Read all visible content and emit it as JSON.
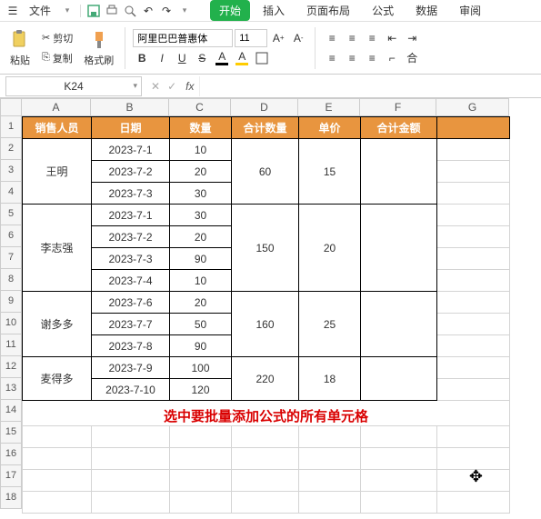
{
  "menubar": {
    "file": "文件",
    "tabs": [
      "开始",
      "插入",
      "页面布局",
      "公式",
      "数据",
      "审阅"
    ],
    "active_tab": 0
  },
  "ribbon": {
    "paste": "粘贴",
    "cut": "剪切",
    "copy": "复制",
    "format_painter": "格式刷",
    "font_name": "阿里巴巴普惠体",
    "font_size": "11",
    "bold": "B",
    "italic": "I",
    "underline": "U",
    "strike": "S",
    "font_color": "A",
    "fill_color": "A",
    "merge": "合"
  },
  "namebox": "K24",
  "formula_prefix": "fx",
  "colors": {
    "header_bg": "#e8953f",
    "annotation": "#d90000"
  },
  "columns": [
    "A",
    "B",
    "C",
    "D",
    "E",
    "F",
    "G"
  ],
  "row_numbers": [
    "1",
    "2",
    "3",
    "4",
    "5",
    "6",
    "7",
    "8",
    "9",
    "10",
    "11",
    "12",
    "13",
    "14",
    "15",
    "16",
    "17",
    "18"
  ],
  "headers": {
    "A": "销售人员",
    "B": "日期",
    "C": "数量",
    "D": "合计数量",
    "E": "单价",
    "F": "合计金额"
  },
  "groups": [
    {
      "name": "王明",
      "rows": [
        [
          "2023-7-1",
          "10"
        ],
        [
          "2023-7-2",
          "20"
        ],
        [
          "2023-7-3",
          "30"
        ]
      ],
      "sum_qty": "60",
      "price": "15"
    },
    {
      "name": "李志强",
      "rows": [
        [
          "2023-7-1",
          "30"
        ],
        [
          "2023-7-2",
          "20"
        ],
        [
          "2023-7-3",
          "90"
        ],
        [
          "2023-7-4",
          "10"
        ]
      ],
      "sum_qty": "150",
      "price": "20"
    },
    {
      "name": "谢多多",
      "rows": [
        [
          "2023-7-6",
          "20"
        ],
        [
          "2023-7-7",
          "50"
        ],
        [
          "2023-7-8",
          "90"
        ]
      ],
      "sum_qty": "160",
      "price": "25"
    },
    {
      "name": "麦得多",
      "rows": [
        [
          "2023-7-9",
          "100"
        ],
        [
          "2023-7-10",
          "120"
        ]
      ],
      "sum_qty": "220",
      "price": "18"
    }
  ],
  "annotation": "选中要批量添加公式的所有单元格",
  "chart_data": {
    "type": "table",
    "title": "",
    "columns": [
      "销售人员",
      "日期",
      "数量",
      "合计数量",
      "单价",
      "合计金额"
    ],
    "rows": [
      [
        "王明",
        "2023-7-1",
        10,
        60,
        15,
        null
      ],
      [
        "王明",
        "2023-7-2",
        20,
        60,
        15,
        null
      ],
      [
        "王明",
        "2023-7-3",
        30,
        60,
        15,
        null
      ],
      [
        "李志强",
        "2023-7-1",
        30,
        150,
        20,
        null
      ],
      [
        "李志强",
        "2023-7-2",
        20,
        150,
        20,
        null
      ],
      [
        "李志强",
        "2023-7-3",
        90,
        150,
        20,
        null
      ],
      [
        "李志强",
        "2023-7-4",
        10,
        150,
        20,
        null
      ],
      [
        "谢多多",
        "2023-7-6",
        20,
        160,
        25,
        null
      ],
      [
        "谢多多",
        "2023-7-7",
        50,
        160,
        25,
        null
      ],
      [
        "谢多多",
        "2023-7-8",
        90,
        160,
        25,
        null
      ],
      [
        "麦得多",
        "2023-7-9",
        100,
        220,
        18,
        null
      ],
      [
        "麦得多",
        "2023-7-10",
        120,
        220,
        18,
        null
      ]
    ]
  }
}
